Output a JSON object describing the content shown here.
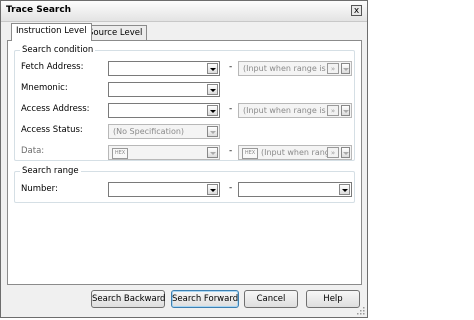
{
  "dialog": {
    "title": "Trace Search",
    "close_glyph": "x"
  },
  "tabs": [
    {
      "label": "Instruction Level",
      "active": true
    },
    {
      "label": "Source Level",
      "active": false
    }
  ],
  "search_condition": {
    "legend": "Search condition",
    "fetch_address": {
      "label": "Fetch Address:",
      "value": "",
      "range_placeholder": "(Input when range is s"
    },
    "mnemonic": {
      "label": "Mnemonic:",
      "value": ""
    },
    "access_address": {
      "label": "Access Address:",
      "value": "",
      "range_placeholder": "(Input when range is s"
    },
    "access_status": {
      "label": "Access Status:",
      "value": "(No Specification)"
    },
    "data": {
      "label": "Data:",
      "value": "",
      "range_placeholder": "(Input when range"
    }
  },
  "search_range": {
    "legend": "Search range",
    "number": {
      "label": "Number:",
      "value": "",
      "value_to": ""
    }
  },
  "range_dash": "-",
  "hex_label": "HEX",
  "range_button_glyph": "»",
  "buttons": {
    "search_backward": "Search Backward",
    "search_forward": "Search Forward",
    "cancel": "Cancel",
    "help": "Help"
  }
}
